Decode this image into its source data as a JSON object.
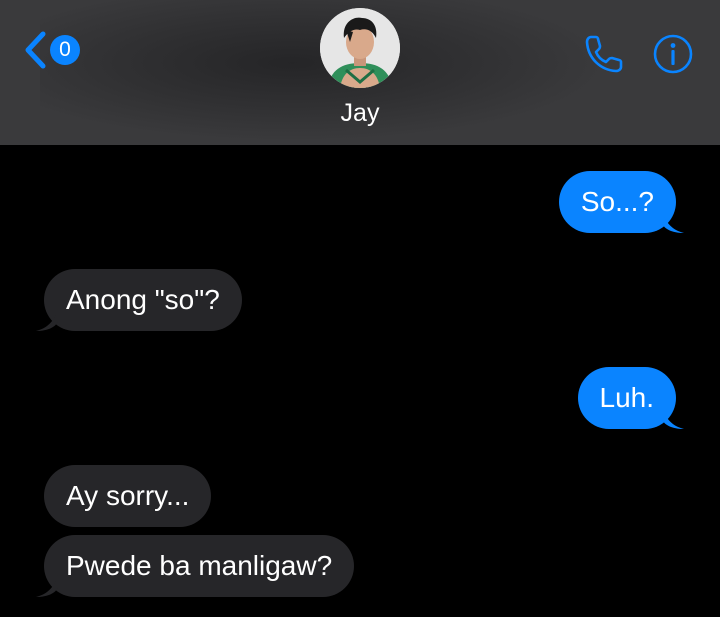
{
  "header": {
    "back_badge_count": "0",
    "contact_name": "Jay",
    "icons": {
      "back": "chevron-left-icon",
      "call": "phone-icon",
      "info": "info-icon"
    },
    "accent_color": "#0a84ff",
    "background_color": "#3a3a3c"
  },
  "messages": [
    {
      "direction": "sent",
      "text": "So...?"
    },
    {
      "direction": "received",
      "text": "Anong \"so\"?"
    },
    {
      "direction": "sent",
      "text": "Luh."
    },
    {
      "direction": "received",
      "text": "Ay sorry..."
    },
    {
      "direction": "received",
      "text": "Pwede ba manligaw?"
    }
  ],
  "colors": {
    "sent_bubble": "#0a84ff",
    "received_bubble": "#262629",
    "thread_background": "#000000"
  }
}
